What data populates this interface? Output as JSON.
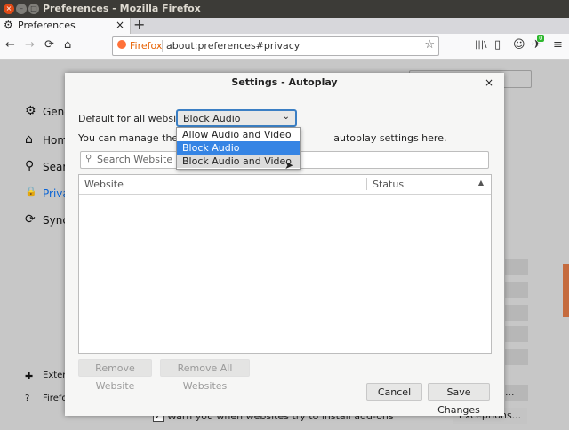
{
  "window": {
    "title": "Preferences - Mozilla Firefox"
  },
  "tab": {
    "label": "Preferences",
    "close": "×",
    "new_tab": "+"
  },
  "navbar": {
    "back": "←",
    "forward": "→",
    "reload": "⟳",
    "home": "⌂",
    "identity_label": "Firefox",
    "url": "about:preferences#privacy",
    "bookmark": "☆",
    "library": "|||\\",
    "sidebar": "▯",
    "account": "☺",
    "menu": "≡",
    "addon_badge": "0"
  },
  "sidebar": {
    "items": [
      {
        "label": "Gene",
        "icon": "⚙"
      },
      {
        "label": "Hom",
        "icon": "⌂"
      },
      {
        "label": "Sear",
        "icon": "⚲"
      },
      {
        "label": "Priva",
        "icon": "🔒"
      },
      {
        "label": "Sync",
        "icon": "⟳"
      },
      {
        "label": "Exter",
        "icon": "✚"
      },
      {
        "label": "Firefo",
        "icon": "?"
      }
    ]
  },
  "dialog": {
    "title": "Settings - Autoplay",
    "close": "×",
    "default_label": "Default for all websites:",
    "selected_value": "Block Audio",
    "chevron": "⌄",
    "manage_text_start": "You can manage the sites",
    "manage_text_end": "autoplay settings here.",
    "search_placeholder": "Search Website",
    "search_icon": "⚲",
    "columns": [
      "Website",
      "Status"
    ],
    "sort_arrow": "▲",
    "buttons": {
      "remove": "Remove Website",
      "remove_all": "Remove All Websites",
      "cancel": "Cancel",
      "save": "Save Changes"
    }
  },
  "dropdown": {
    "options": [
      "Allow Audio and Video",
      "Block Audio",
      "Block Audio and Video"
    ],
    "selected_index": 1,
    "hovered_index": 2
  },
  "background_page": {
    "warn_text": "Warn you when websites try to install add-ons",
    "exceptions_label": "Exceptions...",
    "ellipsis": "..."
  }
}
